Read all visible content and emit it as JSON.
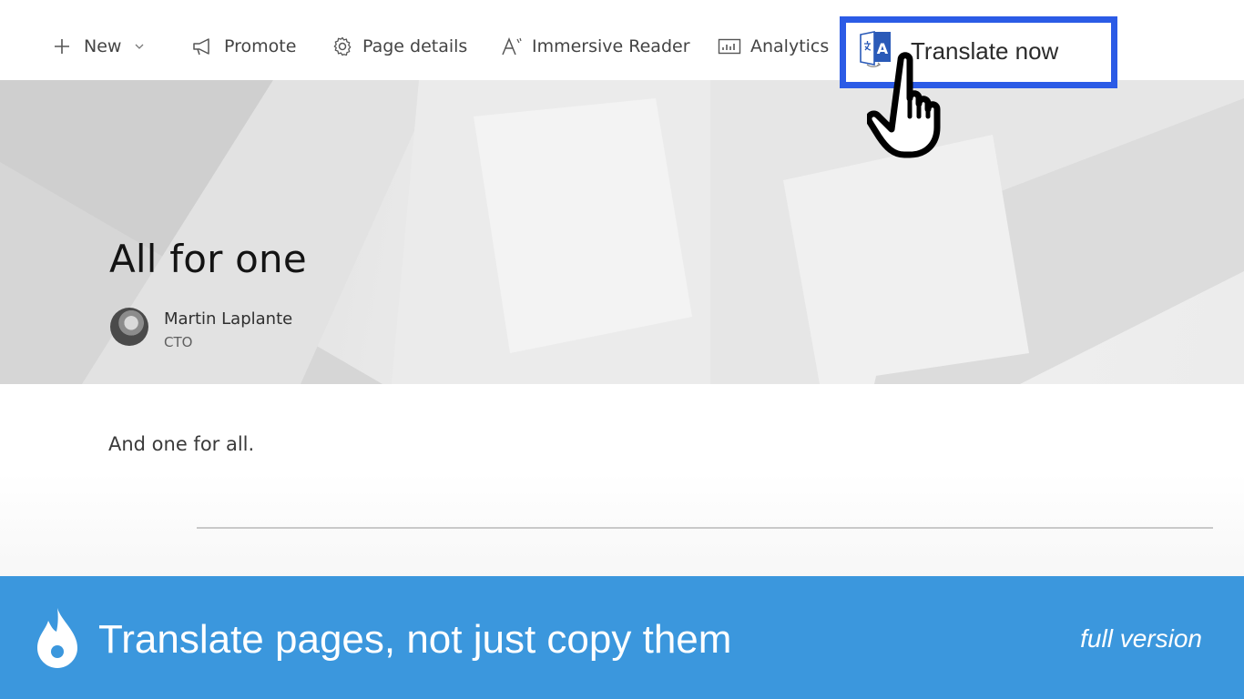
{
  "toolbar": {
    "new_label": "New",
    "promote_label": "Promote",
    "page_details_label": "Page details",
    "immersive_reader_label": "Immersive Reader",
    "analytics_label": "Analytics",
    "translate_label": "Translate now",
    "highlight_color": "#2B5BE6"
  },
  "hero": {
    "title": "All for one",
    "author_name": "Martin Laplante",
    "author_role": "CTO"
  },
  "content": {
    "body_text": "And one for all."
  },
  "banner": {
    "title": "Translate pages, not just copy them",
    "tag": "full version",
    "background_color": "#3B97DD"
  },
  "icons": [
    "plus-icon",
    "chevron-down-icon",
    "megaphone-icon",
    "gear-icon",
    "immersive-reader-icon",
    "analytics-icon",
    "translate-icon",
    "hand-pointer-icon",
    "flame-logo-icon"
  ]
}
